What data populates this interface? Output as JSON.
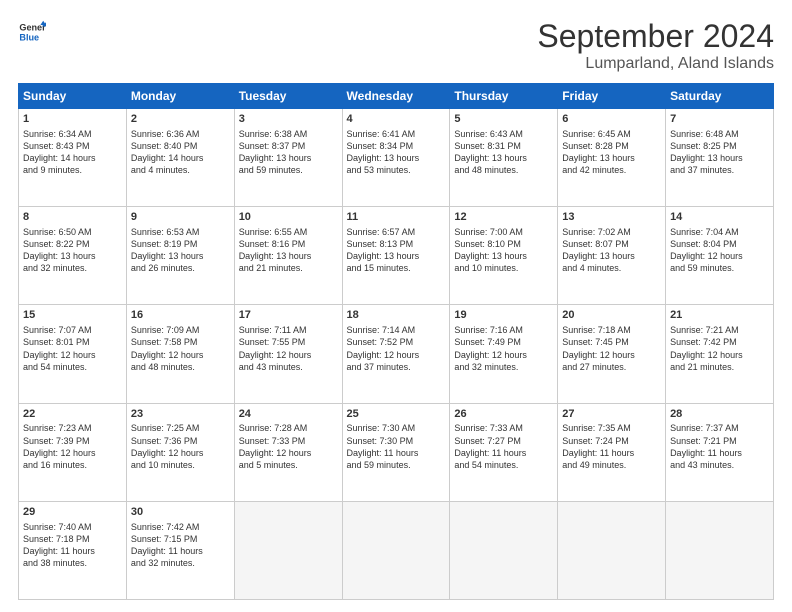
{
  "header": {
    "logo_general": "General",
    "logo_blue": "Blue",
    "month_title": "September 2024",
    "location": "Lumparland, Aland Islands"
  },
  "weekdays": [
    "Sunday",
    "Monday",
    "Tuesday",
    "Wednesday",
    "Thursday",
    "Friday",
    "Saturday"
  ],
  "weeks": [
    [
      {
        "day": "1",
        "lines": [
          "Sunrise: 6:34 AM",
          "Sunset: 8:43 PM",
          "Daylight: 14 hours",
          "and 9 minutes."
        ]
      },
      {
        "day": "2",
        "lines": [
          "Sunrise: 6:36 AM",
          "Sunset: 8:40 PM",
          "Daylight: 14 hours",
          "and 4 minutes."
        ]
      },
      {
        "day": "3",
        "lines": [
          "Sunrise: 6:38 AM",
          "Sunset: 8:37 PM",
          "Daylight: 13 hours",
          "and 59 minutes."
        ]
      },
      {
        "day": "4",
        "lines": [
          "Sunrise: 6:41 AM",
          "Sunset: 8:34 PM",
          "Daylight: 13 hours",
          "and 53 minutes."
        ]
      },
      {
        "day": "5",
        "lines": [
          "Sunrise: 6:43 AM",
          "Sunset: 8:31 PM",
          "Daylight: 13 hours",
          "and 48 minutes."
        ]
      },
      {
        "day": "6",
        "lines": [
          "Sunrise: 6:45 AM",
          "Sunset: 8:28 PM",
          "Daylight: 13 hours",
          "and 42 minutes."
        ]
      },
      {
        "day": "7",
        "lines": [
          "Sunrise: 6:48 AM",
          "Sunset: 8:25 PM",
          "Daylight: 13 hours",
          "and 37 minutes."
        ]
      }
    ],
    [
      {
        "day": "8",
        "lines": [
          "Sunrise: 6:50 AM",
          "Sunset: 8:22 PM",
          "Daylight: 13 hours",
          "and 32 minutes."
        ]
      },
      {
        "day": "9",
        "lines": [
          "Sunrise: 6:53 AM",
          "Sunset: 8:19 PM",
          "Daylight: 13 hours",
          "and 26 minutes."
        ]
      },
      {
        "day": "10",
        "lines": [
          "Sunrise: 6:55 AM",
          "Sunset: 8:16 PM",
          "Daylight: 13 hours",
          "and 21 minutes."
        ]
      },
      {
        "day": "11",
        "lines": [
          "Sunrise: 6:57 AM",
          "Sunset: 8:13 PM",
          "Daylight: 13 hours",
          "and 15 minutes."
        ]
      },
      {
        "day": "12",
        "lines": [
          "Sunrise: 7:00 AM",
          "Sunset: 8:10 PM",
          "Daylight: 13 hours",
          "and 10 minutes."
        ]
      },
      {
        "day": "13",
        "lines": [
          "Sunrise: 7:02 AM",
          "Sunset: 8:07 PM",
          "Daylight: 13 hours",
          "and 4 minutes."
        ]
      },
      {
        "day": "14",
        "lines": [
          "Sunrise: 7:04 AM",
          "Sunset: 8:04 PM",
          "Daylight: 12 hours",
          "and 59 minutes."
        ]
      }
    ],
    [
      {
        "day": "15",
        "lines": [
          "Sunrise: 7:07 AM",
          "Sunset: 8:01 PM",
          "Daylight: 12 hours",
          "and 54 minutes."
        ]
      },
      {
        "day": "16",
        "lines": [
          "Sunrise: 7:09 AM",
          "Sunset: 7:58 PM",
          "Daylight: 12 hours",
          "and 48 minutes."
        ]
      },
      {
        "day": "17",
        "lines": [
          "Sunrise: 7:11 AM",
          "Sunset: 7:55 PM",
          "Daylight: 12 hours",
          "and 43 minutes."
        ]
      },
      {
        "day": "18",
        "lines": [
          "Sunrise: 7:14 AM",
          "Sunset: 7:52 PM",
          "Daylight: 12 hours",
          "and 37 minutes."
        ]
      },
      {
        "day": "19",
        "lines": [
          "Sunrise: 7:16 AM",
          "Sunset: 7:49 PM",
          "Daylight: 12 hours",
          "and 32 minutes."
        ]
      },
      {
        "day": "20",
        "lines": [
          "Sunrise: 7:18 AM",
          "Sunset: 7:45 PM",
          "Daylight: 12 hours",
          "and 27 minutes."
        ]
      },
      {
        "day": "21",
        "lines": [
          "Sunrise: 7:21 AM",
          "Sunset: 7:42 PM",
          "Daylight: 12 hours",
          "and 21 minutes."
        ]
      }
    ],
    [
      {
        "day": "22",
        "lines": [
          "Sunrise: 7:23 AM",
          "Sunset: 7:39 PM",
          "Daylight: 12 hours",
          "and 16 minutes."
        ]
      },
      {
        "day": "23",
        "lines": [
          "Sunrise: 7:25 AM",
          "Sunset: 7:36 PM",
          "Daylight: 12 hours",
          "and 10 minutes."
        ]
      },
      {
        "day": "24",
        "lines": [
          "Sunrise: 7:28 AM",
          "Sunset: 7:33 PM",
          "Daylight: 12 hours",
          "and 5 minutes."
        ]
      },
      {
        "day": "25",
        "lines": [
          "Sunrise: 7:30 AM",
          "Sunset: 7:30 PM",
          "Daylight: 11 hours",
          "and 59 minutes."
        ]
      },
      {
        "day": "26",
        "lines": [
          "Sunrise: 7:33 AM",
          "Sunset: 7:27 PM",
          "Daylight: 11 hours",
          "and 54 minutes."
        ]
      },
      {
        "day": "27",
        "lines": [
          "Sunrise: 7:35 AM",
          "Sunset: 7:24 PM",
          "Daylight: 11 hours",
          "and 49 minutes."
        ]
      },
      {
        "day": "28",
        "lines": [
          "Sunrise: 7:37 AM",
          "Sunset: 7:21 PM",
          "Daylight: 11 hours",
          "and 43 minutes."
        ]
      }
    ],
    [
      {
        "day": "29",
        "lines": [
          "Sunrise: 7:40 AM",
          "Sunset: 7:18 PM",
          "Daylight: 11 hours",
          "and 38 minutes."
        ]
      },
      {
        "day": "30",
        "lines": [
          "Sunrise: 7:42 AM",
          "Sunset: 7:15 PM",
          "Daylight: 11 hours",
          "and 32 minutes."
        ]
      },
      null,
      null,
      null,
      null,
      null
    ]
  ]
}
